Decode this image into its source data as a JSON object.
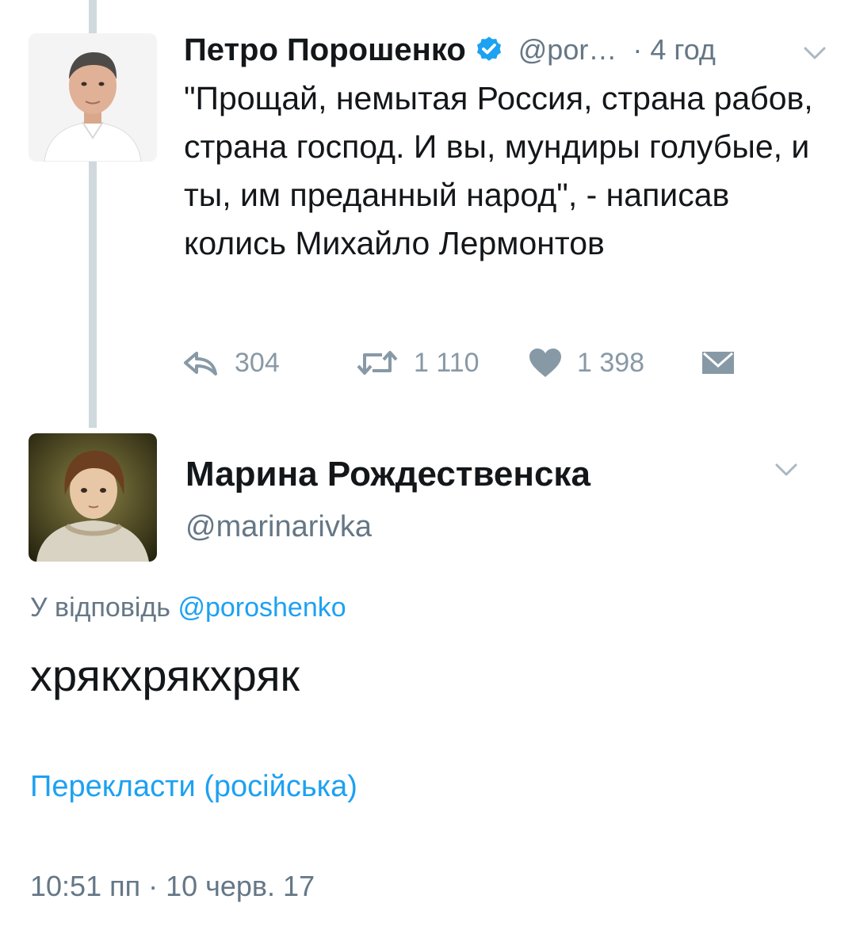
{
  "parent_tweet": {
    "author_name": "Петро Порошенко",
    "handle": "@por…",
    "time": "· 4 год",
    "text": "\"Прощай, немытая Россия, страна рабов, страна господ. И вы, мундиры голубые, и ты, им преданный народ\", - написав колись Михайло Лермонтов",
    "avatar_icon": "person-portrait-icon",
    "verified_icon": "verified-badge-icon",
    "actions": {
      "reply_count": "304",
      "retweet_count": "1 110",
      "like_count": "1 398"
    }
  },
  "reply_tweet": {
    "author_name": "Марина Рождественска",
    "handle": "@marinarivka",
    "avatar_icon": "person-portrait-icon",
    "replying_to_label": "У відповідь",
    "replying_to_handle": "@poroshenko",
    "text": "хрякхрякхряк",
    "translate_label": "Перекласти (російська)",
    "timestamp": "10:51 пп · 10 черв. 17"
  },
  "colors": {
    "accent": "#1da1f2",
    "secondary_text": "#657786",
    "action_gray": "#8899a6",
    "thread_line": "#cfd9de",
    "verified": "#1da1f2"
  }
}
